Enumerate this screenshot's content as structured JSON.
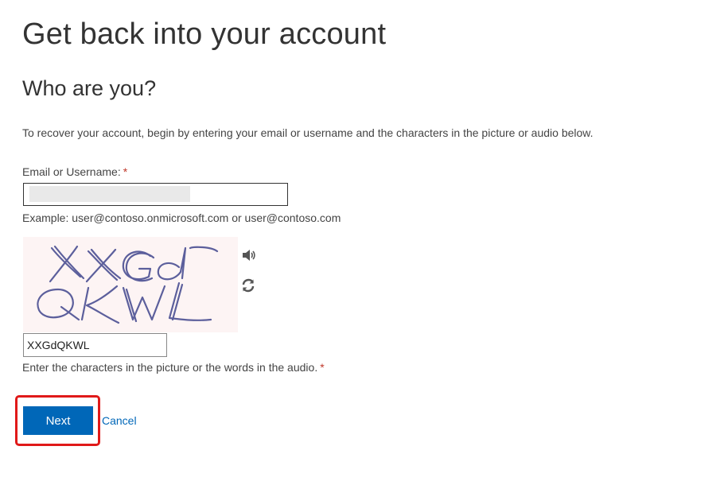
{
  "page": {
    "title": "Get back into your account",
    "subtitle": "Who are you?",
    "intro": "To recover your account, begin by entering your email or username and the characters in the picture or audio below."
  },
  "email": {
    "label": "Email or Username:",
    "required_marker": "*",
    "value": "",
    "example": "Example: user@contoso.onmicrosoft.com or user@contoso.com"
  },
  "captcha": {
    "image_text": "XXGdQKWL",
    "audio_icon": "speaker-icon",
    "refresh_icon": "refresh-icon",
    "input_value": "XXGdQKWL",
    "help_text": "Enter the characters in the picture or the words in the audio.",
    "required_marker": "*"
  },
  "actions": {
    "next_label": "Next",
    "cancel_label": "Cancel",
    "highlight_color": "#e01919"
  },
  "colors": {
    "accent": "#0067b8",
    "required": "#c0392b"
  }
}
